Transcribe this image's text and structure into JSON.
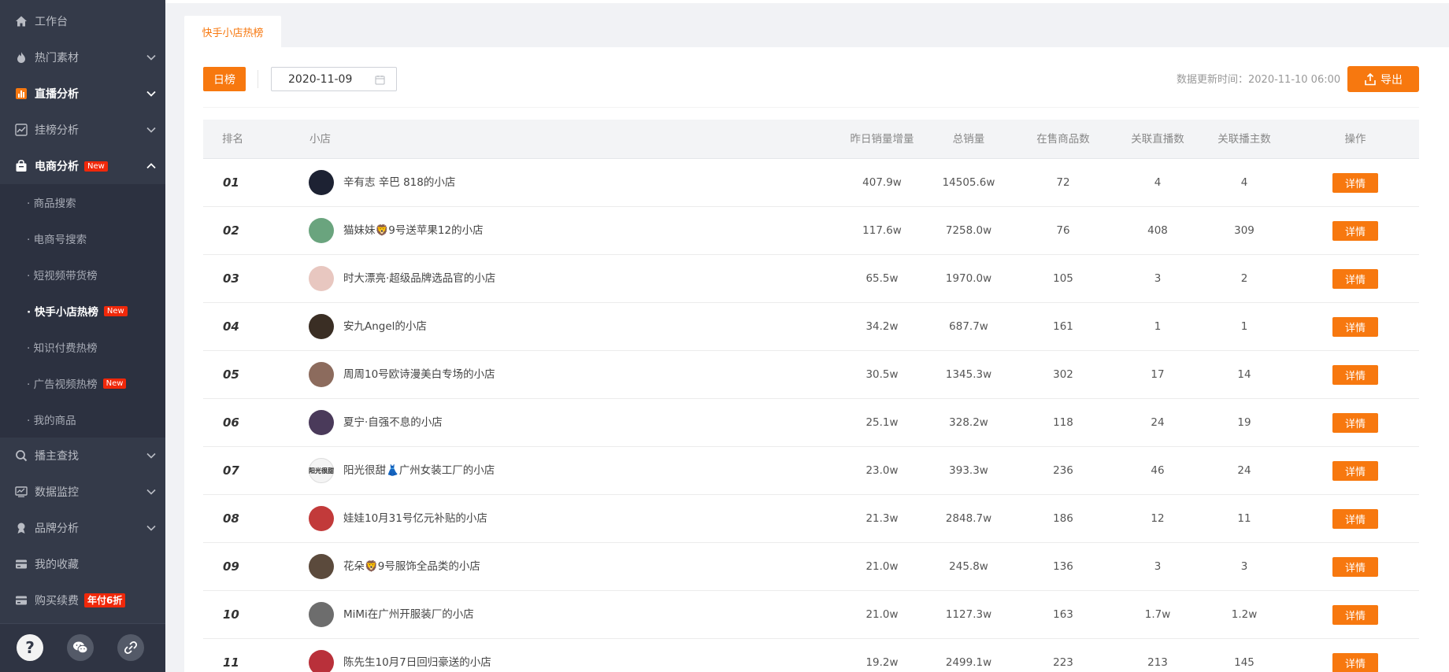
{
  "sidebar": {
    "items": [
      {
        "label": "工作台",
        "icon": "home-icon"
      },
      {
        "label": "热门素材",
        "icon": "fire-icon"
      },
      {
        "label": "直播分析",
        "icon": "bar-chart-icon"
      },
      {
        "label": "挂榜分析",
        "icon": "trend-icon"
      },
      {
        "label": "电商分析",
        "icon": "bag-icon",
        "badge": "New"
      },
      {
        "label": "播主查找",
        "icon": "search-icon"
      },
      {
        "label": "数据监控",
        "icon": "monitor-icon"
      },
      {
        "label": "品牌分析",
        "icon": "brand-icon"
      },
      {
        "label": "我的收藏",
        "icon": "favorites-icon"
      },
      {
        "label": "购买续费",
        "icon": "card-icon",
        "badge": "年付6折"
      }
    ],
    "submenu": [
      {
        "label": "· 商品搜索"
      },
      {
        "label": "· 电商号搜索"
      },
      {
        "label": "· 短视频带货榜"
      },
      {
        "label": "· 快手小店热榜",
        "badge": "New"
      },
      {
        "label": "· 知识付费热榜"
      },
      {
        "label": "· 广告视频热榜",
        "badge": "New"
      },
      {
        "label": "· 我的商品"
      }
    ],
    "footer_icons": [
      "help-icon",
      "wechat-icon",
      "link-icon"
    ]
  },
  "tab": {
    "label": "快手小店热榜"
  },
  "toolbar": {
    "day_label": "日榜",
    "date_value": "2020-11-09",
    "update_time": "数据更新时间：2020-11-10 06:00",
    "export_label": "导出"
  },
  "table": {
    "headers": {
      "rank": "排名",
      "shop": "小店",
      "yesterday_sales": "昨日销量增量",
      "total_sales": "总销量",
      "products": "在售商品数",
      "lives": "关联直播数",
      "streamers": "关联播主数",
      "action": "操作"
    },
    "detail_label": "详情",
    "rows": [
      {
        "rank": "01",
        "name": "辛有志 辛巴 818的小店",
        "yesterday": "407.9w",
        "total": "14505.6w",
        "products": "72",
        "lives": "4",
        "streamers": "4",
        "avatar_color": "#1d2233"
      },
      {
        "rank": "02",
        "name": "猫妹妹🦁9号送苹果12的小店",
        "yesterday": "117.6w",
        "total": "7258.0w",
        "products": "76",
        "lives": "408",
        "streamers": "309",
        "avatar_color": "#6aa47e"
      },
      {
        "rank": "03",
        "name": "时大漂亮·超级品牌选品官的小店",
        "yesterday": "65.5w",
        "total": "1970.0w",
        "products": "105",
        "lives": "3",
        "streamers": "2",
        "avatar_color": "#e8c7c0"
      },
      {
        "rank": "04",
        "name": "安九Angel的小店",
        "yesterday": "34.2w",
        "total": "687.7w",
        "products": "161",
        "lives": "1",
        "streamers": "1",
        "avatar_color": "#3a2e24"
      },
      {
        "rank": "05",
        "name": "周周10号欧诗漫美白专场的小店",
        "yesterday": "30.5w",
        "total": "1345.3w",
        "products": "302",
        "lives": "17",
        "streamers": "14",
        "avatar_color": "#8c6b5d"
      },
      {
        "rank": "06",
        "name": "夏宁·自强不息的小店",
        "yesterday": "25.1w",
        "total": "328.2w",
        "products": "118",
        "lives": "24",
        "streamers": "19",
        "avatar_color": "#4a3a5a"
      },
      {
        "rank": "07",
        "name": "阳光很甜👗广州女装工厂的小店",
        "yesterday": "23.0w",
        "total": "393.3w",
        "products": "236",
        "lives": "46",
        "streamers": "24",
        "avatar_color": "#f4f4f4",
        "avatar_text": "阳光很甜"
      },
      {
        "rank": "08",
        "name": "娃娃10月31号亿元补贴的小店",
        "yesterday": "21.3w",
        "total": "2848.7w",
        "products": "186",
        "lives": "12",
        "streamers": "11",
        "avatar_color": "#c23a3a"
      },
      {
        "rank": "09",
        "name": "花朵🦁9号服饰全品类的小店",
        "yesterday": "21.0w",
        "total": "245.8w",
        "products": "136",
        "lives": "3",
        "streamers": "3",
        "avatar_color": "#5b4a3c"
      },
      {
        "rank": "10",
        "name": "MiMi在广州开服装厂的小店",
        "yesterday": "21.0w",
        "total": "1127.3w",
        "products": "163",
        "lives": "1.7w",
        "streamers": "1.2w",
        "avatar_color": "#6d6d6d"
      },
      {
        "rank": "11",
        "name": "陈先生10月7日回归豪送的小店",
        "yesterday": "19.2w",
        "total": "2499.1w",
        "products": "223",
        "lives": "213",
        "streamers": "145",
        "avatar_color": "#b9303a"
      }
    ]
  }
}
